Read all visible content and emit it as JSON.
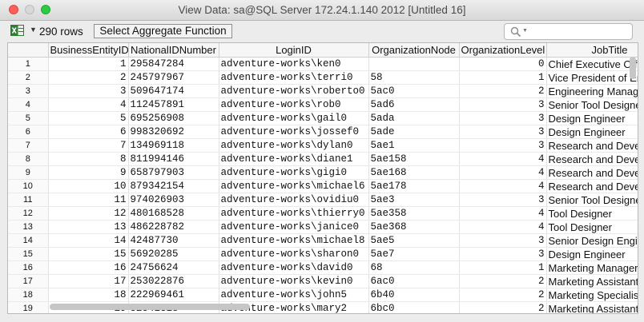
{
  "window": {
    "title": "View Data: sa@SQL Server 172.24.1.140 2012 [Untitled 16]"
  },
  "toolbar": {
    "row_count": "290 rows",
    "aggregate_button": "Select Aggregate Function",
    "icons": {
      "export": "excel-icon",
      "search": "search-icon"
    }
  },
  "grid": {
    "columns": [
      "",
      "BusinessEntityID",
      "NationalIDNumber",
      "LoginID",
      "OrganizationNode",
      "OrganizationLevel",
      "JobTitle"
    ],
    "rows": [
      [
        "1",
        "1",
        "295847284",
        "adventure-works\\ken0",
        "",
        "0",
        "Chief Executive Officer"
      ],
      [
        "2",
        "2",
        "245797967",
        "adventure-works\\terri0",
        "58",
        "1",
        "Vice President of Engineering"
      ],
      [
        "3",
        "3",
        "509647174",
        "adventure-works\\roberto0",
        "5ac0",
        "2",
        "Engineering Manager"
      ],
      [
        "4",
        "4",
        "112457891",
        "adventure-works\\rob0",
        "5ad6",
        "3",
        "Senior Tool Designer"
      ],
      [
        "5",
        "5",
        "695256908",
        "adventure-works\\gail0",
        "5ada",
        "3",
        "Design Engineer"
      ],
      [
        "6",
        "6",
        "998320692",
        "adventure-works\\jossef0",
        "5ade",
        "3",
        "Design Engineer"
      ],
      [
        "7",
        "7",
        "134969118",
        "adventure-works\\dylan0",
        "5ae1",
        "3",
        "Research and Development Manager"
      ],
      [
        "8",
        "8",
        "811994146",
        "adventure-works\\diane1",
        "5ae158",
        "4",
        "Research and Development Engineer"
      ],
      [
        "9",
        "9",
        "658797903",
        "adventure-works\\gigi0",
        "5ae168",
        "4",
        "Research and Development Engineer"
      ],
      [
        "10",
        "10",
        "879342154",
        "adventure-works\\michael6",
        "5ae178",
        "4",
        "Research and Development Manager"
      ],
      [
        "11",
        "11",
        "974026903",
        "adventure-works\\ovidiu0",
        "5ae3",
        "3",
        "Senior Tool Designer"
      ],
      [
        "12",
        "12",
        "480168528",
        "adventure-works\\thierry0",
        "5ae358",
        "4",
        "Tool Designer"
      ],
      [
        "13",
        "13",
        "486228782",
        "adventure-works\\janice0",
        "5ae368",
        "4",
        "Tool Designer"
      ],
      [
        "14",
        "14",
        "42487730",
        "adventure-works\\michael8",
        "5ae5",
        "3",
        "Senior Design Engineer"
      ],
      [
        "15",
        "15",
        "56920285",
        "adventure-works\\sharon0",
        "5ae7",
        "3",
        "Design Engineer"
      ],
      [
        "16",
        "16",
        "24756624",
        "adventure-works\\david0",
        "68",
        "1",
        "Marketing Manager"
      ],
      [
        "17",
        "17",
        "253022876",
        "adventure-works\\kevin0",
        "6ac0",
        "2",
        "Marketing Assistant"
      ],
      [
        "18",
        "18",
        "222969461",
        "adventure-works\\john5",
        "6b40",
        "2",
        "Marketing Specialist"
      ],
      [
        "19",
        "19",
        "52541318",
        "adventure-works\\mary2",
        "6bc0",
        "2",
        "Marketing Assistant"
      ]
    ]
  }
}
